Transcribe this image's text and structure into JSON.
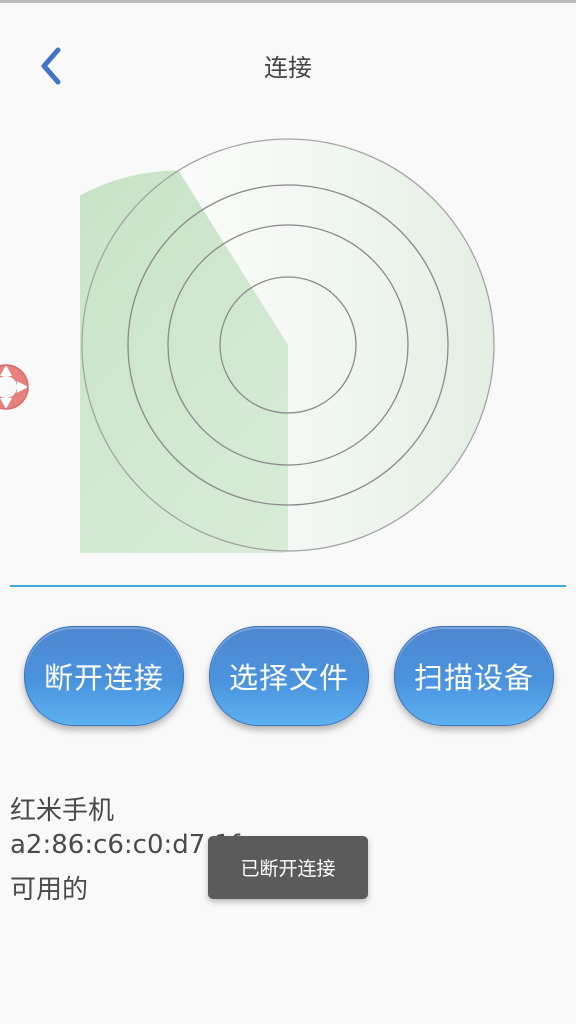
{
  "header": {
    "title": "连接",
    "back_icon": "chevron-left-icon"
  },
  "radar": {
    "icon": "radar-scan-icon",
    "sweep_color": "#c9e5c9"
  },
  "float_icon": "lifebuoy-icon",
  "buttons": {
    "disconnect_label": "断开连接",
    "select_file_label": "选择文件",
    "scan_devices_label": "扫描设备"
  },
  "device": {
    "name": "红米手机",
    "mac": "a2:86:c6:c0:d7:1f",
    "status": "可用的"
  },
  "toast": {
    "message": "已断开连接"
  },
  "colors": {
    "accent": "#3f74c8",
    "divider": "#3fa9d8",
    "button": "#4a93de"
  }
}
